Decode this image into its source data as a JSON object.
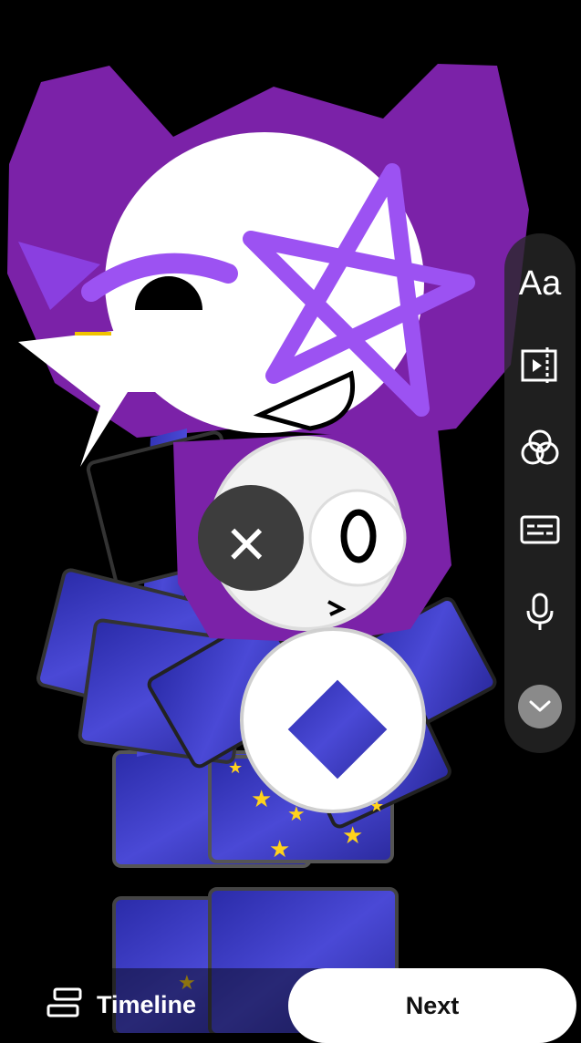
{
  "editor": {
    "preview": {
      "content": "character-artwork-preview"
    },
    "tools": {
      "text_label": "Aa",
      "icons": [
        "text-icon",
        "trim-icon",
        "filters-icon",
        "captions-icon",
        "microphone-icon",
        "chevron-down-icon"
      ]
    },
    "bottom_bar": {
      "timeline_label": "Timeline",
      "next_label": "Next"
    },
    "colors": {
      "background": "#000000",
      "purple": "#7b22a8",
      "star_purple": "#9c52f2",
      "next_button": "#ffffff"
    }
  }
}
